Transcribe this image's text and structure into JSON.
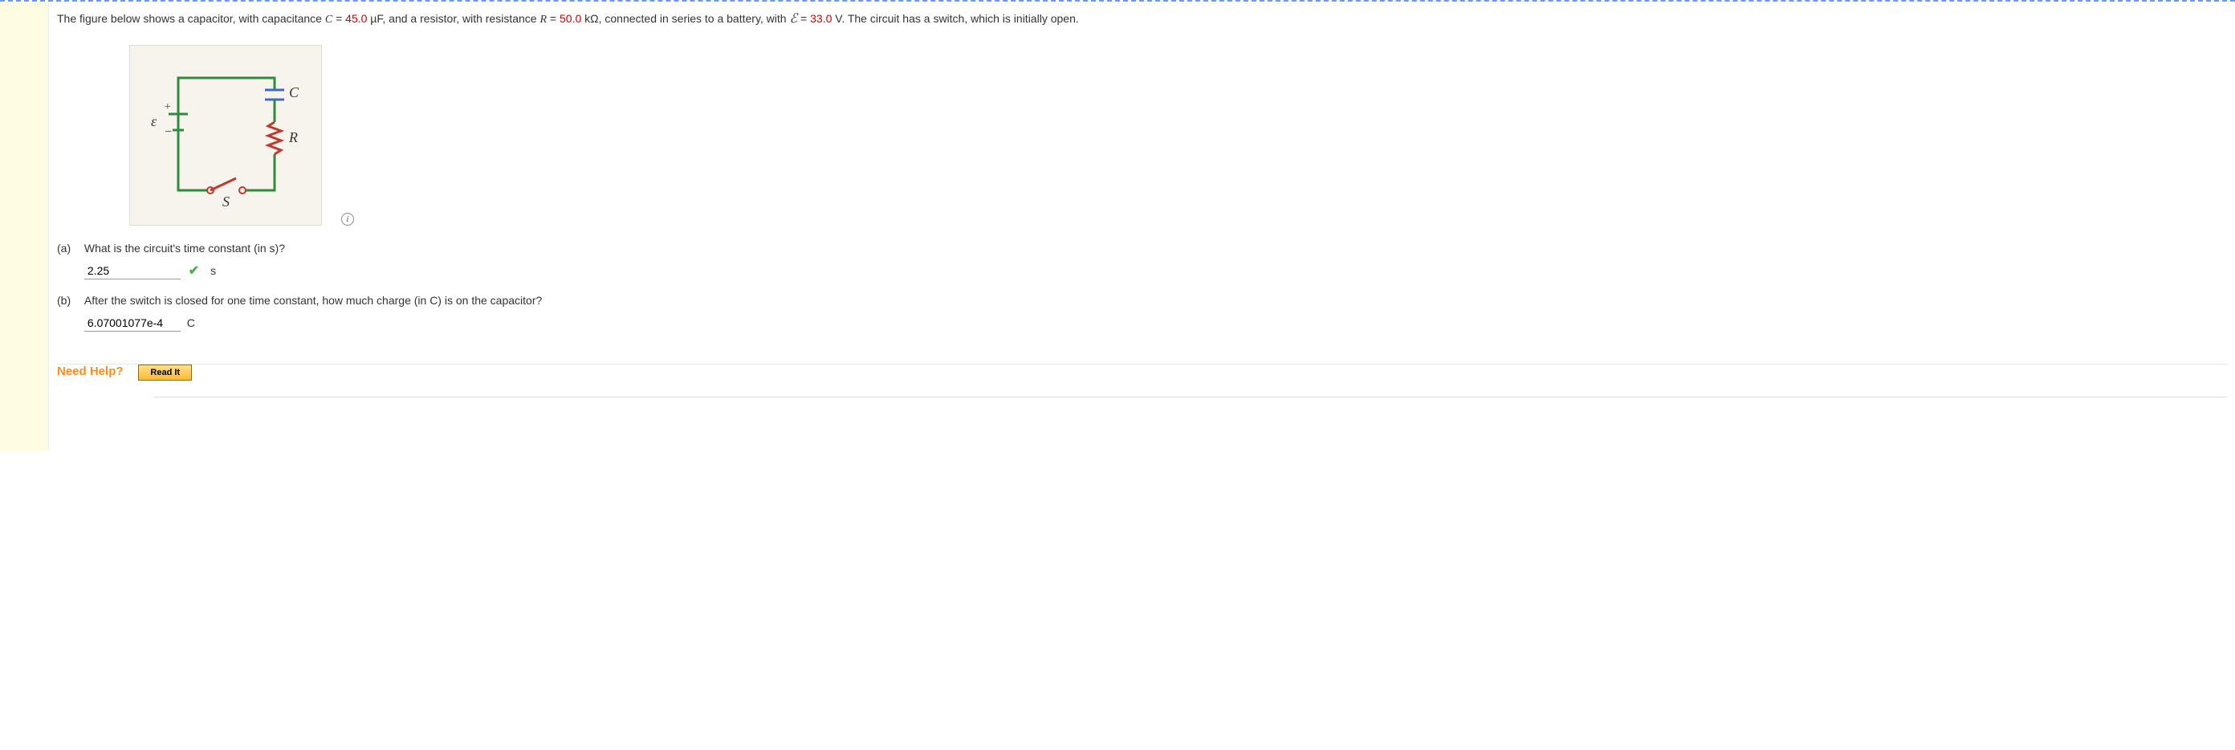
{
  "problem": {
    "intro_before_C": "The figure below shows a capacitor, with capacitance ",
    "C_var": "C",
    "eq1": " = ",
    "C_val": "45.0",
    "C_unit": " µF, and a resistor, with resistance ",
    "R_var": "R",
    "eq2": " = ",
    "R_val": "50.0",
    "R_unit": " kΩ, connected in series to a battery, with ",
    "emf_sym": "ℰ",
    "eq3": " = ",
    "E_val": "33.0",
    "E_unit": " V. The circuit has a switch, which is initially open."
  },
  "circuit_labels": {
    "emf": "ε",
    "plus": "+",
    "minus": "−",
    "C": "C",
    "R": "R",
    "S": "S"
  },
  "info_icon_glyph": "i",
  "parts": {
    "a": {
      "label": "(a)",
      "question": "What is the circuit's time constant (in s)?",
      "answer": "2.25",
      "unit": "s",
      "correct": true
    },
    "b": {
      "label": "(b)",
      "question": "After the switch is closed for one time constant, how much charge (in C) is on the capacitor?",
      "answer": "6.07001077e-4",
      "unit": "C",
      "correct": false
    }
  },
  "help": {
    "label": "Need Help?",
    "read_it": "Read It"
  },
  "check_glyph": "✔"
}
